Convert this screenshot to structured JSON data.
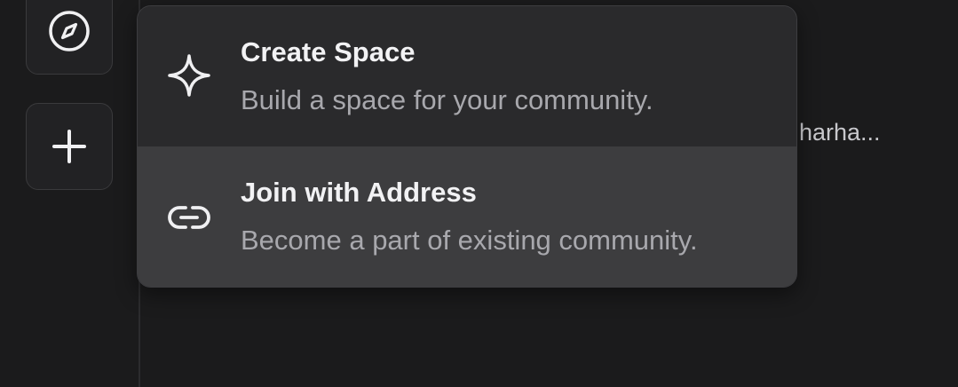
{
  "sidebar": {
    "items": [
      {
        "icon": "compass-icon"
      },
      {
        "icon": "plus-icon"
      }
    ]
  },
  "background": {
    "truncated_text": "harha..."
  },
  "menu": {
    "items": [
      {
        "icon": "sparkle-icon",
        "title": "Create Space",
        "description": "Build a space for your community."
      },
      {
        "icon": "link-icon",
        "title": "Join with Address",
        "description": "Become a part of existing community."
      }
    ]
  },
  "colors": {
    "background": "#1b1b1c",
    "menu_background": "#2a2a2c",
    "menu_item_hover": "#3d3d3f",
    "title_text": "#f2f2f4",
    "description_text": "#a8a8ad"
  }
}
